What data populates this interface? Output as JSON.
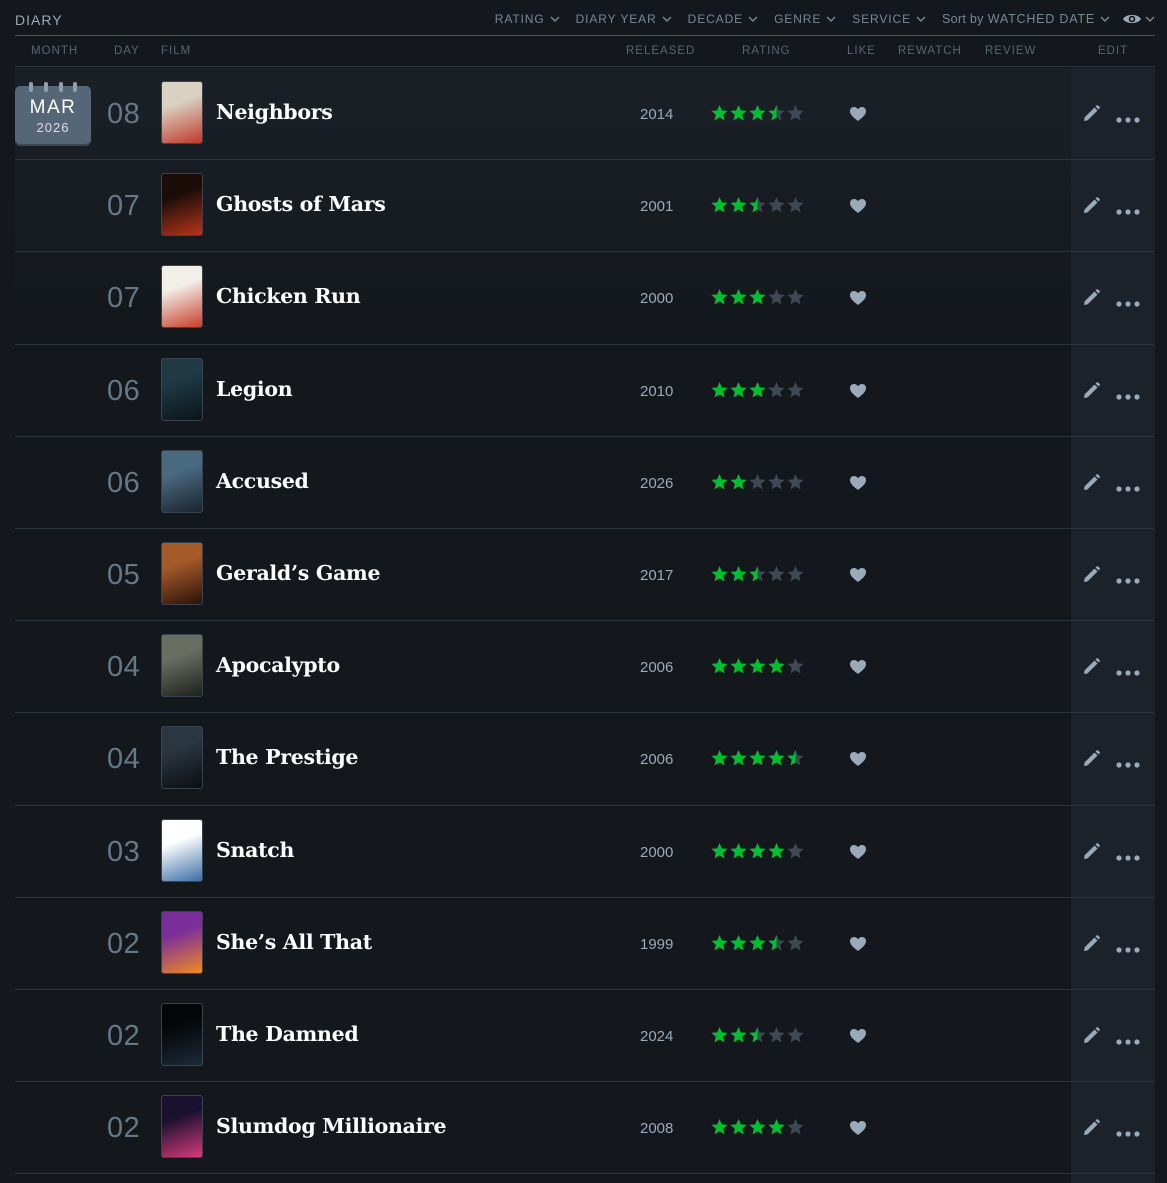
{
  "header": {
    "title": "DIARY",
    "filters": [
      "RATING",
      "DIARY YEAR",
      "DECADE",
      "GENRE",
      "SERVICE"
    ],
    "sort_prefix": "Sort by",
    "sort_value": "WATCHED DATE"
  },
  "columns": {
    "month": "MONTH",
    "day": "DAY",
    "film": "FILM",
    "released": "RELEASED",
    "rating": "RATING",
    "like": "LIKE",
    "rewatch": "REWATCH",
    "review": "REVIEW",
    "edit": "EDIT"
  },
  "calendar": {
    "month": "MAR",
    "year": "2026"
  },
  "colors": {
    "background": "#14181c",
    "star_on": "#00c030",
    "star_off": "#3f4956",
    "title": "#ffffff"
  },
  "entries": [
    {
      "day": "08",
      "title": "Neighbors",
      "year": "2014",
      "rating": 3.5,
      "liked": true,
      "poster": [
        "#d9d2c2",
        "#c0392b"
      ]
    },
    {
      "day": "07",
      "title": "Ghosts of Mars",
      "year": "2001",
      "rating": 2.5,
      "liked": true,
      "poster": [
        "#1a0d08",
        "#b8341b"
      ]
    },
    {
      "day": "07",
      "title": "Chicken Run",
      "year": "2000",
      "rating": 3,
      "liked": true,
      "poster": [
        "#f2efe8",
        "#c93d2a"
      ]
    },
    {
      "day": "06",
      "title": "Legion",
      "year": "2010",
      "rating": 3,
      "liked": true,
      "poster": [
        "#1f3a44",
        "#0c1418"
      ]
    },
    {
      "day": "06",
      "title": "Accused",
      "year": "2026",
      "rating": 2,
      "liked": true,
      "poster": [
        "#4a6a80",
        "#1a2430"
      ]
    },
    {
      "day": "05",
      "title": "Gerald’s Game",
      "year": "2017",
      "rating": 2.5,
      "liked": true,
      "poster": [
        "#a55a2a",
        "#2a120a"
      ]
    },
    {
      "day": "04",
      "title": "Apocalypto",
      "year": "2006",
      "rating": 4,
      "liked": true,
      "poster": [
        "#6a6e62",
        "#1e211c"
      ]
    },
    {
      "day": "04",
      "title": "The Prestige",
      "year": "2006",
      "rating": 4.5,
      "liked": true,
      "poster": [
        "#2a3640",
        "#0b0f12"
      ]
    },
    {
      "day": "03",
      "title": "Snatch",
      "year": "2000",
      "rating": 4,
      "liked": true,
      "poster": [
        "#ffffff",
        "#3a6ea5"
      ]
    },
    {
      "day": "02",
      "title": "She’s All That",
      "year": "1999",
      "rating": 3.5,
      "liked": true,
      "poster": [
        "#7a2e9a",
        "#f08a20"
      ]
    },
    {
      "day": "02",
      "title": "The Damned",
      "year": "2024",
      "rating": 2.5,
      "liked": true,
      "poster": [
        "#050608",
        "#1c2a38"
      ]
    },
    {
      "day": "02",
      "title": "Slumdog Millionaire",
      "year": "2008",
      "rating": 4,
      "liked": true,
      "poster": [
        "#1a1030",
        "#d63a7a"
      ]
    }
  ]
}
